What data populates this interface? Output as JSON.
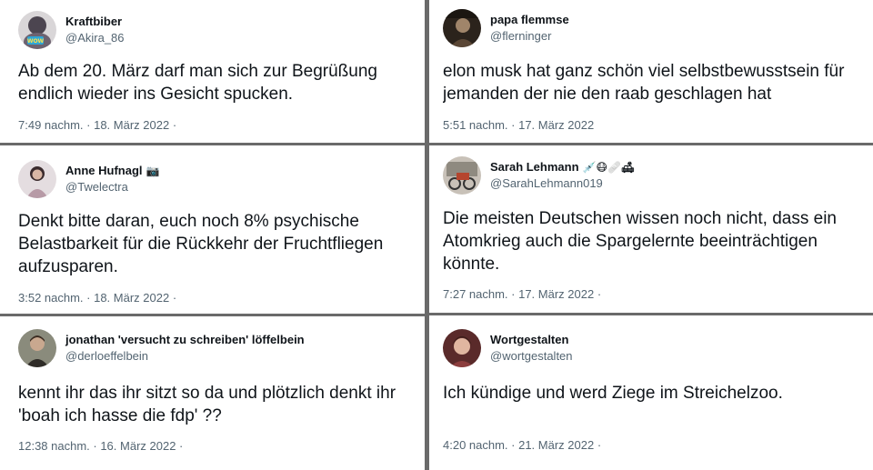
{
  "tweets": [
    {
      "name": "Kraftbiber",
      "handle": "@Akira_86",
      "text": "Ab dem 20. März darf man sich zur Begrüßung\nendlich wieder ins Gesicht spucken.",
      "meta": "7:49 nachm. · 18. März 2022 ·",
      "avatar_icon": "sticker-avatar-icon",
      "avatar_color": "#8a7f86"
    },
    {
      "name": "papa flemmse",
      "handle": "@flerninger",
      "text": "elon musk hat ganz schön viel selbstbewusstsein für\njemanden der nie den raab geschlagen hat",
      "meta": "5:51 nachm. · 17. März 2022",
      "avatar_icon": "portrait-avatar-icon",
      "avatar_color": "#3a3026"
    },
    {
      "name": "Anne Hufnagl",
      "name_badge": "📷",
      "handle": "@Twelectra",
      "text": "Denkt bitte daran, euch noch 8% psychische\nBelastbarkeit für die Rückkehr der Fruchtfliegen\naufzusparen.",
      "meta": "3:52 nachm. · 18. März 2022 ·",
      "avatar_icon": "person-avatar-icon",
      "avatar_color": "#b9a6ad"
    },
    {
      "name": "Sarah Lehmann",
      "name_badge": "💉😷🩹🛋",
      "handle": "@SarahLehmann019",
      "text": "Die meisten Deutschen wissen noch nicht, dass ein\nAtomkrieg auch die Spargelernte beeinträchtigen\nkönnte.",
      "meta": "7:27 nachm. · 17. März 2022 ·",
      "avatar_icon": "bike-avatar-icon",
      "avatar_color": "#9a5a3c"
    },
    {
      "name": "jonathan 'versucht zu schreiben' löffelbein",
      "handle": "@derloeffelbein",
      "text": "kennt ihr das ihr sitzt so da und plötzlich denkt ihr\n'boah ich hasse die fdp' ??",
      "meta": "12:38 nachm. · 16. März 2022 ·",
      "avatar_icon": "man-avatar-icon",
      "avatar_color": "#6f7160"
    },
    {
      "name": "Wortgestalten",
      "handle": "@wortgestalten",
      "text": "Ich kündige und werd Ziege im Streichelzoo.",
      "meta": "4:20 nachm. · 21. März 2022 ·",
      "avatar_icon": "woman-avatar-icon",
      "avatar_color": "#7a3a3a"
    }
  ]
}
